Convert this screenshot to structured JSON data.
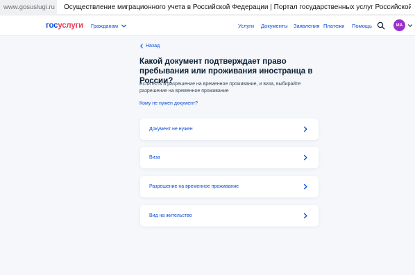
{
  "browser": {
    "url": "www.gosuslugi.ru",
    "title": "Осуществление миграционного учета в Российской Федерации | Портал государственных услуг Российской Феде..."
  },
  "header": {
    "logo_part1": "гос",
    "logo_part2": "услуги",
    "audience": "Гражданам",
    "nav": [
      "Услуги",
      "Документы",
      "Заявления",
      "Платежи",
      "Помощь"
    ],
    "avatar_initials": "ИА"
  },
  "main": {
    "back_label": "Назад",
    "title": "Какой документ подтверждает право пребывания или проживания иностранца в России?",
    "description": "Если есть и разрешение на временное проживание, и виза, выбирайте разрешение на временное проживание",
    "help_link": "Кому не нужен документ?",
    "options": [
      "Документ не нужен",
      "Виза",
      "Разрешение на временное проживание",
      "Вид на жительство"
    ]
  },
  "colors": {
    "accent": "#0d4cd3",
    "brand_red": "#ee3f58",
    "avatar": "#9b2ecf",
    "background": "#f5f7fa"
  }
}
